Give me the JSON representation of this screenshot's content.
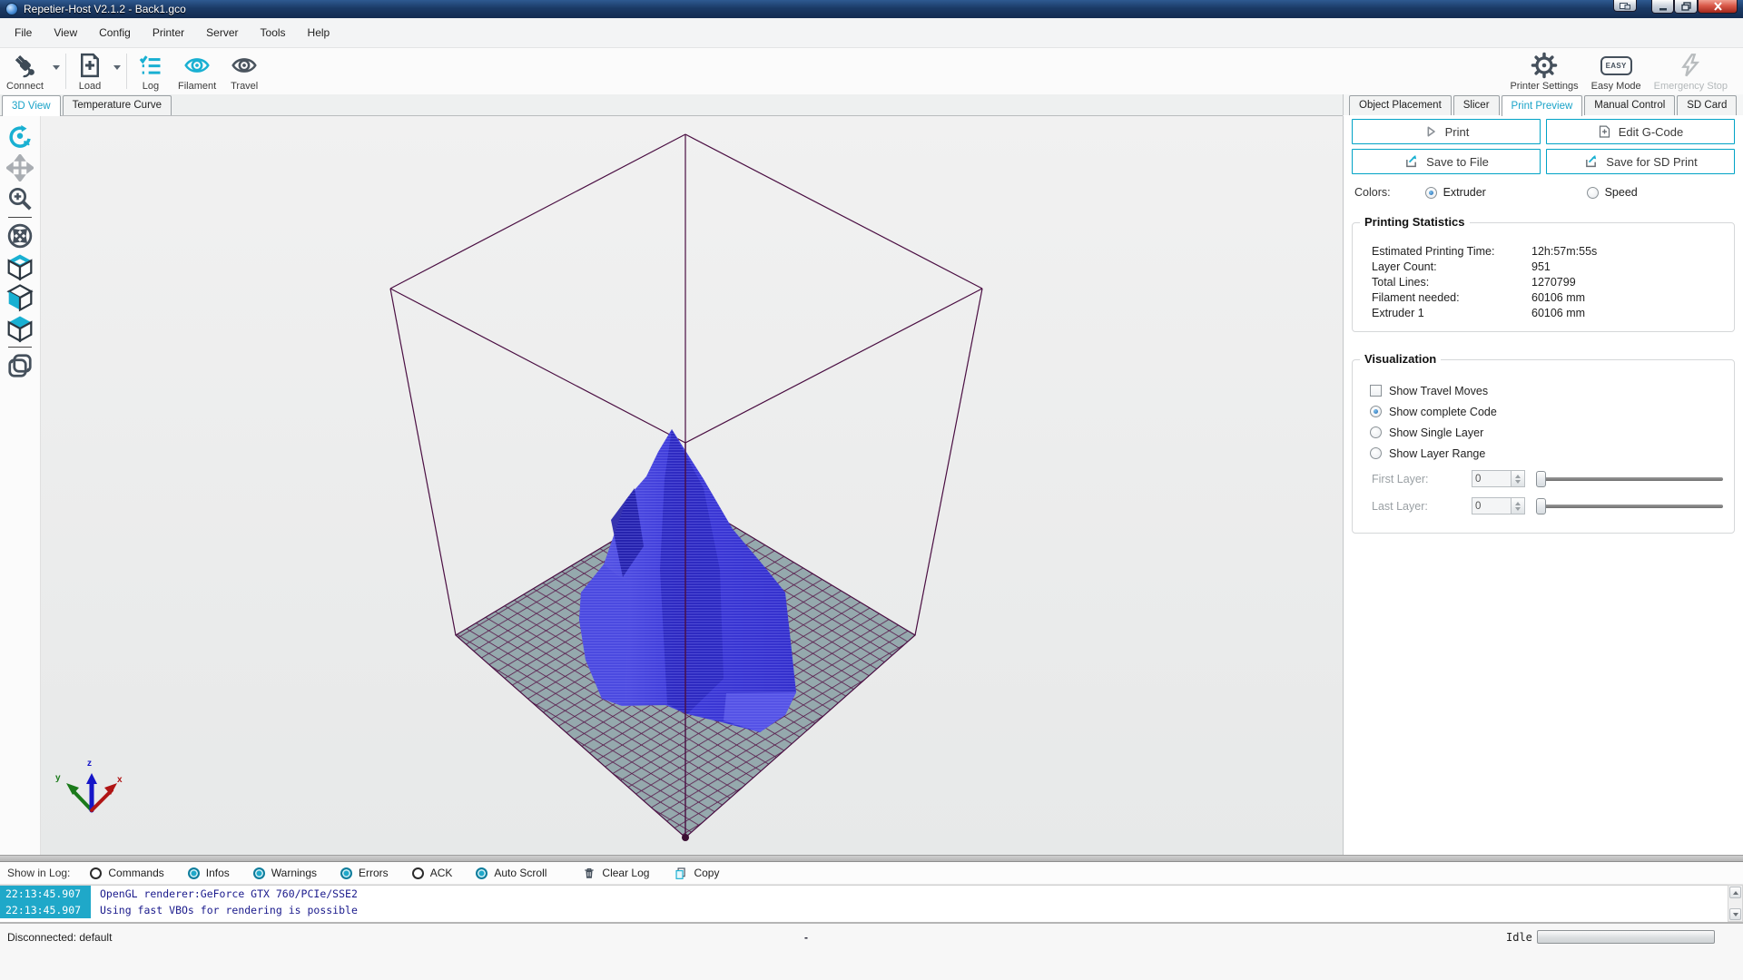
{
  "window": {
    "title": "Repetier-Host V2.1.2 - Back1.gco"
  },
  "menu": {
    "items": [
      "File",
      "View",
      "Config",
      "Printer",
      "Server",
      "Tools",
      "Help"
    ]
  },
  "toolbar": {
    "connect": "Connect",
    "load": "Load",
    "log": "Log",
    "filament": "Filament",
    "travel": "Travel",
    "printer_settings": "Printer Settings",
    "easy_mode": "Easy Mode",
    "easy_badge": "EASY",
    "emergency_stop": "Emergency Stop"
  },
  "view_tabs": {
    "view3d": "3D View",
    "temperature": "Temperature Curve",
    "active": "3D View"
  },
  "panel_tabs": {
    "object_placement": "Object Placement",
    "slicer": "Slicer",
    "print_preview": "Print Preview",
    "manual_control": "Manual Control",
    "sd_card": "SD Card",
    "active": "Print Preview"
  },
  "preview": {
    "print": "Print",
    "edit_gcode": "Edit G-Code",
    "save_to_file": "Save to File",
    "save_sd": "Save for SD Print",
    "colors_label": "Colors:",
    "color_options": {
      "extruder": "Extruder",
      "speed": "Speed",
      "selected": "Extruder"
    },
    "stats": {
      "title": "Printing Statistics",
      "rows": [
        {
          "label": "Estimated Printing Time:",
          "value": "12h:57m:55s"
        },
        {
          "label": "Layer Count:",
          "value": "951"
        },
        {
          "label": "Total Lines:",
          "value": "1270799"
        },
        {
          "label": "Filament needed:",
          "value": "60106 mm"
        },
        {
          "label": "Extruder 1",
          "value": "60106 mm"
        }
      ]
    },
    "visualization": {
      "title": "Visualization",
      "show_travel_moves": {
        "label": "Show Travel Moves",
        "checked": false
      },
      "show_complete_code": {
        "label": "Show complete Code",
        "checked": true
      },
      "show_single_layer": {
        "label": "Show Single Layer",
        "checked": false
      },
      "show_layer_range": {
        "label": "Show Layer Range",
        "checked": false
      },
      "first_layer": {
        "label": "First Layer:",
        "value": "0"
      },
      "last_layer": {
        "label": "Last Layer:",
        "value": "0"
      }
    }
  },
  "log": {
    "show_in_log": "Show in Log:",
    "toggles": [
      {
        "label": "Commands",
        "on": false
      },
      {
        "label": "Infos",
        "on": true
      },
      {
        "label": "Warnings",
        "on": true
      },
      {
        "label": "Errors",
        "on": true
      },
      {
        "label": "ACK",
        "on": false
      },
      {
        "label": "Auto Scroll",
        "on": true
      }
    ],
    "clear_log": "Clear Log",
    "copy": "Copy",
    "entries": [
      {
        "time": "22:13:45.907",
        "text": "OpenGL renderer:GeForce GTX 760/PCIe/SSE2"
      },
      {
        "time": "22:13:45.907",
        "text": "Using fast VBOs for rendering is possible"
      }
    ]
  },
  "status": {
    "connection": "Disconnected: default",
    "center": "-",
    "state": "Idle"
  },
  "colors": {
    "accent": "#00a3c6",
    "model_blue": "#3937d6",
    "model_dark": "#2b28bd",
    "model_light": "#5b5be8",
    "bed_fill": "#95a9ad",
    "grid_line": "#5b2150",
    "wireframe": "#4a0e42",
    "log_time_bg": "#1fa8c9",
    "log_text": "#1a1a8c"
  }
}
